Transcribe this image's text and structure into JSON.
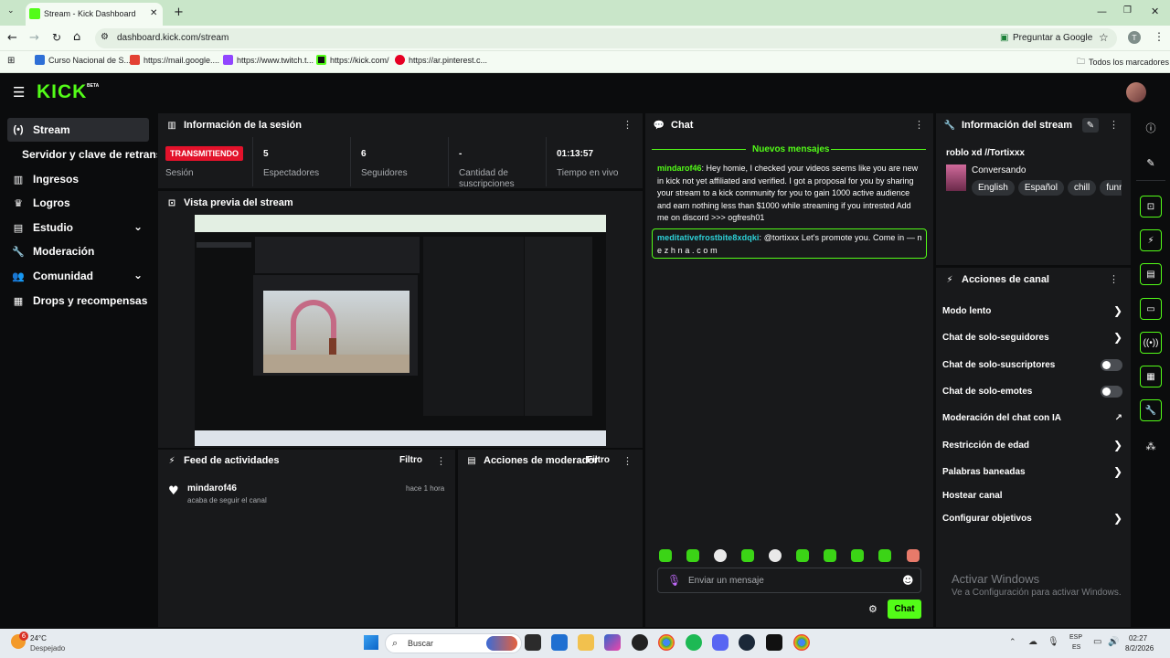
{
  "browser": {
    "tab_title": "Stream - Kick Dashboard",
    "url": "dashboard.kick.com/stream",
    "ask_google": "Preguntar a Google",
    "profile_initial": "T",
    "bookmarks": [
      "Curso Nacional de S...",
      "https://mail.google....",
      "https://www.twitch.t...",
      "https://kick.com/",
      "https://ar.pinterest.c..."
    ],
    "all_bookmarks": "Todos los marcadores"
  },
  "brand": {
    "logo": "KICK",
    "beta": "BETA"
  },
  "sidebar": {
    "items": [
      {
        "label": "Stream",
        "icon": "broadcast-icon"
      },
      {
        "label": "Servidor y clave de retransmisión"
      },
      {
        "label": "Ingresos",
        "icon": "chart-icon"
      },
      {
        "label": "Logros",
        "icon": "trophy-icon"
      },
      {
        "label": "Estudio",
        "icon": "studio-icon"
      },
      {
        "label": "Moderación",
        "icon": "wrench-icon"
      },
      {
        "label": "Comunidad",
        "icon": "people-icon"
      },
      {
        "label": "Drops y recompensas",
        "icon": "gift-icon"
      }
    ]
  },
  "session": {
    "title": "Información de la sesión",
    "live_badge": "TRANSMITIENDO",
    "stats": [
      {
        "value": "",
        "label": "Sesión"
      },
      {
        "value": "5",
        "label": "Espectadores"
      },
      {
        "value": "6",
        "label": "Seguidores"
      },
      {
        "value": "-",
        "label": "Cantidad de suscripciones"
      },
      {
        "value": "01:13:57",
        "label": "Tiempo en vivo"
      }
    ]
  },
  "preview": {
    "title": "Vista previa del stream"
  },
  "activity": {
    "title": "Feed de actividades",
    "filter": "Filtro",
    "items": [
      {
        "user": "mindarof46",
        "text": "acaba de seguir el canal",
        "time": "hace 1 hora"
      }
    ]
  },
  "modactions": {
    "title": "Acciones de moderador",
    "filter": "Filtro"
  },
  "chat": {
    "title": "Chat",
    "new_messages": "Nuevos mensajes",
    "messages": [
      {
        "user": "mindarof46",
        "text": "Hey homie, I checked your videos seems like you are new in kick not yet affiliated and verified. I got a proposal for you by sharing your stream to a kick community for you to gain 1000 active audience and earn nothing less than $1000 while streaming if you intrested Add me on discord >>> ogfresh01"
      },
      {
        "user": "meditativefrostbite8xdqki",
        "text": "@tortixxx Let's promote you. Come in — n e z h n a . c o m"
      }
    ],
    "input_placeholder": "Enviar un mensaje",
    "send_label": "Chat",
    "user_color": "#53fc18"
  },
  "stream_info": {
    "title": "Información del stream",
    "stream_title": "roblo xd //Tortixxx",
    "category": "Conversando",
    "tags": [
      "English",
      "Español",
      "chill",
      "funny"
    ]
  },
  "channel_actions": {
    "title": "Acciones de canal",
    "items": [
      {
        "label": "Modo lento",
        "control": "chevron"
      },
      {
        "label": "Chat de solo-seguidores",
        "control": "chevron"
      },
      {
        "label": "Chat de solo-suscriptores",
        "control": "toggle"
      },
      {
        "label": "Chat de solo-emotes",
        "control": "toggle"
      },
      {
        "label": "Moderación del chat con IA",
        "control": "external"
      },
      {
        "label": "Restricción de edad",
        "control": "chevron"
      },
      {
        "label": "Palabras baneadas",
        "control": "chevron"
      },
      {
        "label": "Hostear canal",
        "control": "none"
      },
      {
        "label": "Configurar objetivos",
        "control": "chevron"
      }
    ]
  },
  "watermark": {
    "line1": "Activar Windows",
    "line2": "Ve a Configuración para activar Windows."
  },
  "taskbar": {
    "weather_temp": "24°C",
    "weather_desc": "Despejado",
    "weather_badge": "6",
    "search": "Buscar",
    "lang1": "ESP",
    "lang2": "ES",
    "time": "02:27",
    "date": "8/2/2026"
  },
  "colors": {
    "accent": "#53fc18",
    "live": "#e3122b",
    "panel": "#18191b"
  }
}
